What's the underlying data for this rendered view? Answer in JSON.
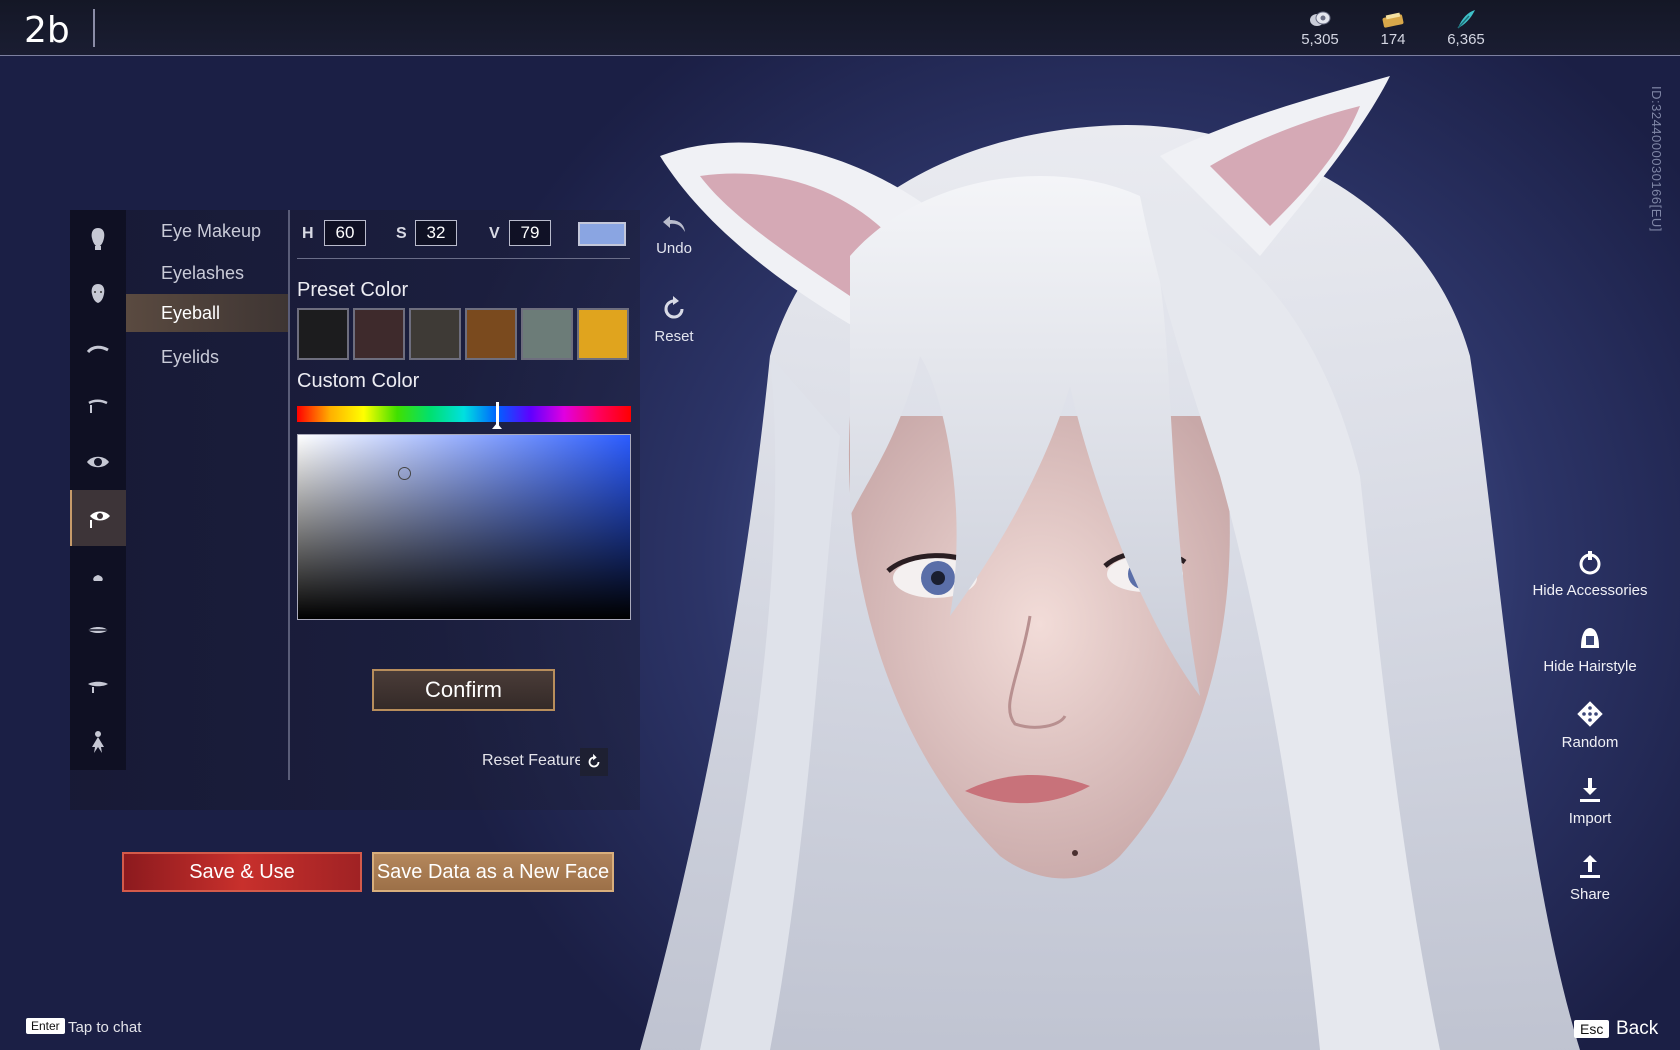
{
  "header": {
    "character_name": "2b",
    "currencies": [
      {
        "icon": "coin-icon",
        "value": "5,305"
      },
      {
        "icon": "ticket-icon",
        "value": "174"
      },
      {
        "icon": "feather-icon",
        "value": "6,365"
      }
    ],
    "server_id": "ID:3244000030166[EU]"
  },
  "categories": [
    {
      "icon": "head-icon"
    },
    {
      "icon": "face-icon"
    },
    {
      "icon": "eyebrow-icon"
    },
    {
      "icon": "brow-detail-icon"
    },
    {
      "icon": "eye-icon"
    },
    {
      "icon": "eye-makeup-icon",
      "active": true
    },
    {
      "icon": "nose-icon"
    },
    {
      "icon": "lips-icon"
    },
    {
      "icon": "mouth-icon"
    },
    {
      "icon": "body-icon"
    }
  ],
  "subcategories": [
    {
      "label": "Eye Makeup"
    },
    {
      "label": "Eyelashes"
    },
    {
      "label": "Eyeball",
      "active": true
    },
    {
      "label": "Eyelids"
    }
  ],
  "hsv": {
    "h_label": "H",
    "h_value": "60",
    "s_label": "S",
    "s_value": "32",
    "v_label": "V",
    "v_value": "79",
    "current_color": "#8aa5e2"
  },
  "preset": {
    "title": "Preset Color",
    "colors": [
      "#1c1c1e",
      "#3e2a2c",
      "#3e3a36",
      "#7a4a1e",
      "#6c7c78",
      "#e0a41e"
    ]
  },
  "custom": {
    "title": "Custom Color",
    "hue_position": 0.6,
    "saturation_marker": {
      "s": 0.32,
      "v": 0.79
    }
  },
  "actions": {
    "confirm": "Confirm",
    "reset_feature": "Reset Feature",
    "undo": "Undo",
    "reset": "Reset",
    "save_use": "Save & Use",
    "save_new": "Save Data as a New Face"
  },
  "right_tools": [
    {
      "icon": "accessories-icon",
      "label": "Hide Accessories"
    },
    {
      "icon": "hairstyle-icon",
      "label": "Hide Hairstyle"
    },
    {
      "icon": "dice-icon",
      "label": "Random"
    },
    {
      "icon": "import-icon",
      "label": "Import"
    },
    {
      "icon": "share-icon",
      "label": "Share"
    }
  ],
  "footer": {
    "enter_key": "Enter",
    "chat_hint": "Tap to chat",
    "esc_key": "Esc",
    "back": "Back"
  },
  "colors": {
    "accent_gold": "#c79b6a",
    "save_red": "#c8302c",
    "background": "#2c3467"
  }
}
